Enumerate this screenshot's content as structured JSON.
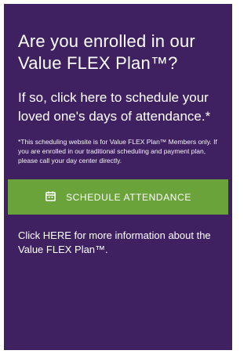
{
  "card": {
    "headline": "Are you enrolled in our Value FLEX Plan™?",
    "subhead": "If so, click here to schedule your loved one's days of attendance.*",
    "note": "*This scheduling website is for Value FLEX Plan™ Members only. If you are enrolled in our traditional scheduling and payment plan, please call your day center directly.",
    "cta": {
      "label": "SCHEDULE ATTENDANCE",
      "icon": "calendar-icon"
    },
    "more_link": "Click HERE for more information about the Value FLEX Plan™."
  },
  "colors": {
    "card_background": "#3f2161",
    "cta_background": "#6aa33a",
    "text": "#ffffff"
  }
}
